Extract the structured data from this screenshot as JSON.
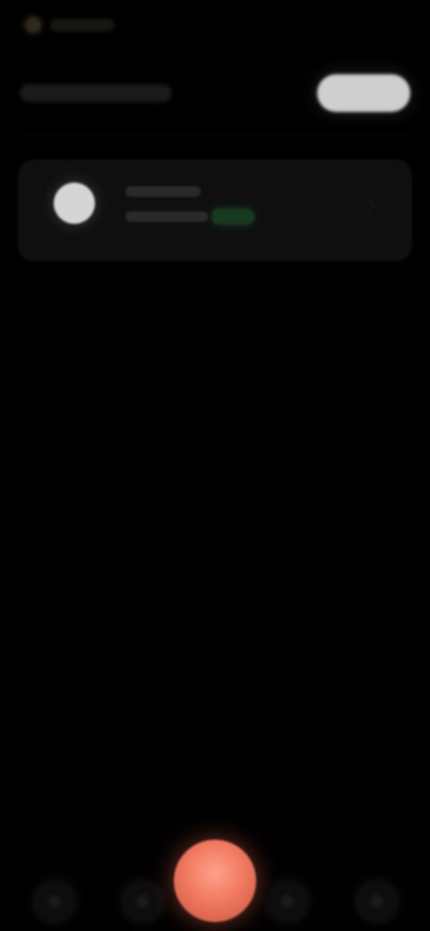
{
  "app": {
    "background": "#000000"
  },
  "topbar": {
    "icon": "status-dot-icon"
  },
  "header": {
    "title": "",
    "pill_label": ""
  },
  "card": {
    "avatar_icon": "avatar-icon",
    "status_color": "#1f7a35"
  },
  "bottom_nav": {
    "items": [
      {
        "icon": "home-icon"
      },
      {
        "icon": "search-icon"
      },
      {
        "icon": "library-icon"
      },
      {
        "icon": "profile-icon"
      }
    ],
    "fab_icon": "record-icon",
    "fab_color": "#f07a60"
  }
}
